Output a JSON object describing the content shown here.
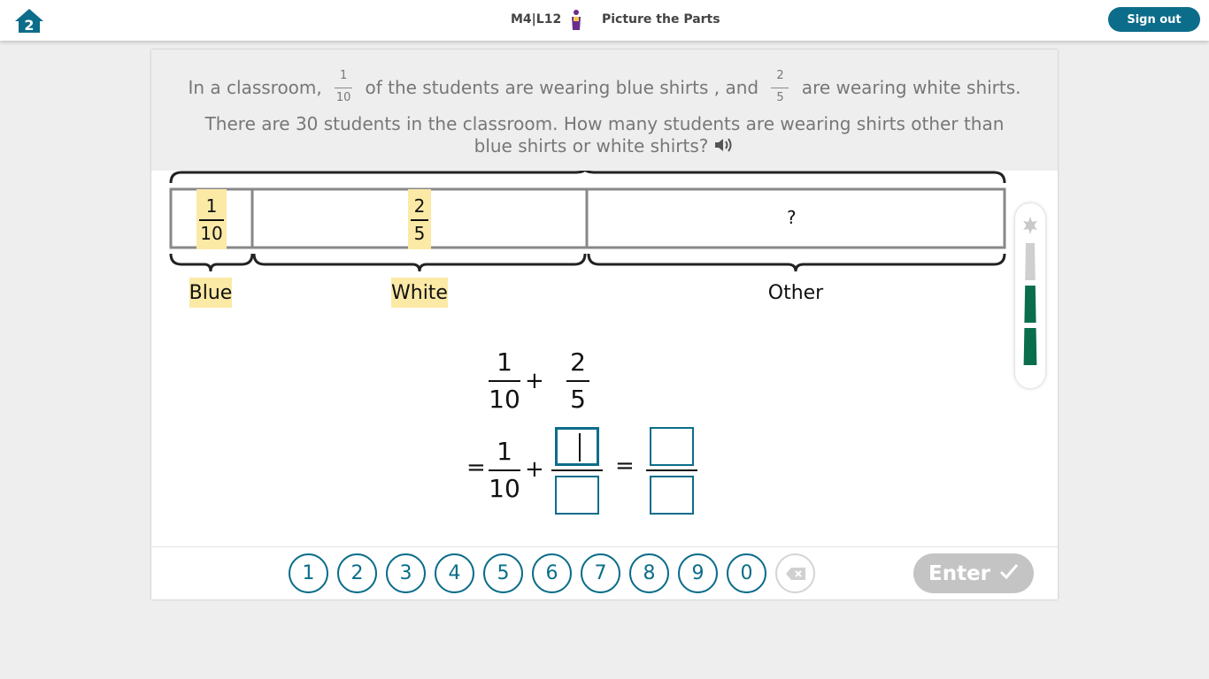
{
  "header": {
    "lesson_code": "M4|L12",
    "lesson_title": "Picture the Parts",
    "signout_label": "Sign out",
    "brand_color": "#0b6d8a",
    "home_icon": "home-icon",
    "lesson_icon": "student-figure-icon"
  },
  "prompt": {
    "part1": "In a classroom, ",
    "frac1": {
      "num": "1",
      "den": "10"
    },
    "part2": " of the students are wearing blue shirts , and ",
    "frac2": {
      "num": "2",
      "den": "5"
    },
    "part3": " are wearing white shirts.",
    "line2": "There are 30 students in the classroom. How many students are wearing shirts other than blue shirts or white shirts?",
    "speaker_icon": "speaker-icon"
  },
  "tape": {
    "seg1": {
      "num": "1",
      "den": "10"
    },
    "seg2": {
      "num": "2",
      "den": "5"
    },
    "seg3_text": "?",
    "labels": {
      "blue": "Blue",
      "white": "White",
      "other": "Other"
    },
    "highlight_color": "#fbe9a6"
  },
  "equation": {
    "row1": {
      "frac_a": {
        "num": "1",
        "den": "10"
      },
      "plus": "+",
      "frac_b": {
        "num": "2",
        "den": "5"
      }
    },
    "row2": {
      "equals1": "=",
      "frac_a": {
        "num": "1",
        "den": "10"
      },
      "plus": "+",
      "equals2": "=",
      "answer_boxes": [
        "",
        "",
        "",
        ""
      ]
    }
  },
  "gauge": {
    "filled_levels": 2,
    "total_levels": 3,
    "fill_color": "#0a6e4d",
    "star_icon": "star-icon"
  },
  "keypad": {
    "keys": [
      "1",
      "2",
      "3",
      "4",
      "5",
      "6",
      "7",
      "8",
      "9",
      "0"
    ],
    "backspace_icon": "backspace-icon",
    "enter_label": "Enter",
    "enter_icon": "checkmark-icon"
  }
}
